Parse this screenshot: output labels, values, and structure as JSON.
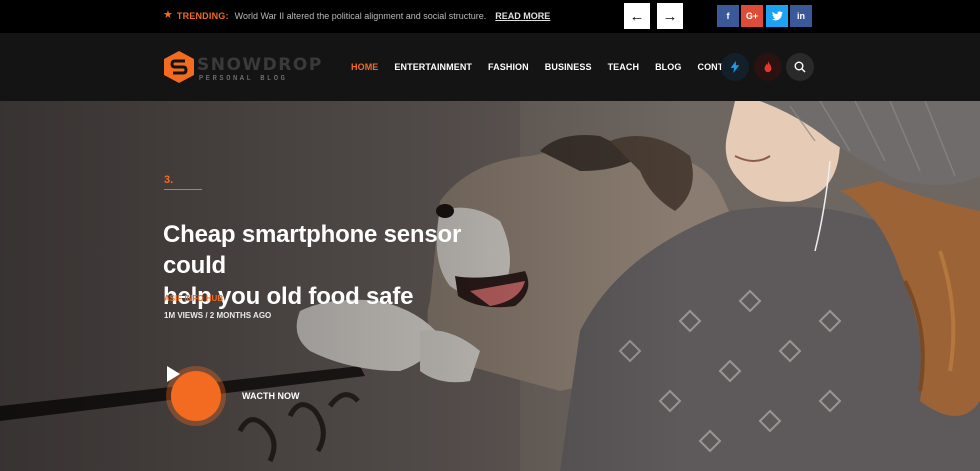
{
  "topbar": {
    "trending_label": "TRENDING:",
    "trending_text": "World War II altered the political alignment and social structure.",
    "read_more": "READ MORE",
    "social": [
      {
        "label": "f",
        "icon": "facebook-icon",
        "color": "#3b5998"
      },
      {
        "label": "G+",
        "icon": "google-plus-icon",
        "color": "#dd4b39"
      },
      {
        "label": "t",
        "icon": "twitter-icon",
        "color": "#1da1f2"
      },
      {
        "label": "in",
        "icon": "linkedin-icon",
        "color": "#3b5998"
      }
    ]
  },
  "header": {
    "logo_name": "SNOWDROP",
    "logo_sub": "PERSONAL BLOG",
    "nav": [
      "HOME",
      "ENTERTAINMENT",
      "FASHION",
      "BUSINESS",
      "TEACH",
      "BLOG",
      "CONTACT"
    ],
    "nav_active": "HOME",
    "icons": [
      "bolt-icon",
      "fire-icon",
      "search-icon"
    ]
  },
  "hero": {
    "number": "3.",
    "title_line1": "Cheap smartphone sensor could",
    "title_line2": "help you old food safe",
    "author": "ASIF INFO HUB",
    "meta": "1M VIEWS / 2 MONTHS AGO",
    "watch_label": "WACTH NOW"
  },
  "colors": {
    "accent": "#f26b21",
    "topbar_bg": "#000000",
    "header_bg": "#141414"
  }
}
